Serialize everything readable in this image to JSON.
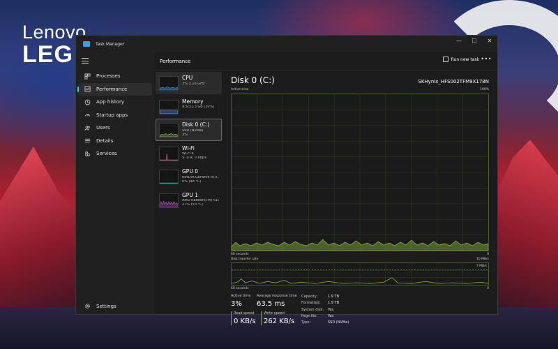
{
  "wallpaper": {
    "brand_top": "Lenovo",
    "brand_bottom": "LEG"
  },
  "window": {
    "title": "Task Manager",
    "controls": {
      "minimize": "—",
      "maximize": "☐",
      "close": "✕"
    }
  },
  "sidebar": {
    "items": [
      {
        "label": "Processes",
        "icon": "processes-grid-icon"
      },
      {
        "label": "Performance",
        "icon": "performance-chart-icon",
        "active": true
      },
      {
        "label": "App history",
        "icon": "history-clock-icon"
      },
      {
        "label": "Startup apps",
        "icon": "startup-gauge-icon"
      },
      {
        "label": "Users",
        "icon": "users-icon"
      },
      {
        "label": "Details",
        "icon": "details-list-icon"
      },
      {
        "label": "Services",
        "icon": "services-puzzle-icon"
      }
    ],
    "settings_label": "Settings"
  },
  "header": {
    "title": "Performance",
    "run_new_task": "Run new task",
    "more": "•••"
  },
  "devices": [
    {
      "name": "CPU",
      "sub1": "3% 3.16 GHz",
      "sub2": "",
      "color": "#3a9be0"
    },
    {
      "name": "Memory",
      "sub1": "9.5/31.3 GB (30%)",
      "sub2": "",
      "color": "#5aa0ff"
    },
    {
      "name": "Disk 0 (C:)",
      "sub1": "SSD (NVMe)",
      "sub2": "3%",
      "color": "#8ab83a"
    },
    {
      "name": "Wi-Fi",
      "sub1": "Wi-Fi 6",
      "sub2": "S: 0 R: 0 Kbps",
      "color": "#d04a7a"
    },
    {
      "name": "GPU 0",
      "sub1": "NVIDIA GeForce RTX...",
      "sub2": "0% (48 °C)",
      "color": "#2aa8a8"
    },
    {
      "name": "GPU 1",
      "sub1": "AMD Radeon(TM) 610...",
      "sub2": "27% (53 °C)",
      "color": "#b04ab8"
    }
  ],
  "detail": {
    "title": "Disk 0 (C:)",
    "model": "SKHynix_HFS002TFM9X178N",
    "active_time": {
      "label": "Active time",
      "max": "100%",
      "x_left": "60 seconds",
      "x_right": "0"
    },
    "transfer": {
      "label": "Disk transfer rate",
      "max": "10 MB/s",
      "mid": "7 MB/s",
      "x_left": "60 seconds",
      "x_right": "0"
    },
    "stats": {
      "active_time_label": "Active time",
      "active_time": "3%",
      "response_label": "Average response time",
      "response": "63.5 ms",
      "read_label": "Read speed",
      "read": "0 KB/s",
      "write_label": "Write speed",
      "write": "262 KB/s"
    },
    "properties": [
      {
        "k": "Capacity:",
        "v": "1.9 TB"
      },
      {
        "k": "Formatted:",
        "v": "1.9 TB"
      },
      {
        "k": "System disk:",
        "v": "Yes"
      },
      {
        "k": "Page file:",
        "v": "Yes"
      },
      {
        "k": "Type:",
        "v": "SSD (NVMe)"
      }
    ],
    "colors": {
      "accent": "#8ab83a",
      "grid": "#2e3a1e"
    }
  }
}
